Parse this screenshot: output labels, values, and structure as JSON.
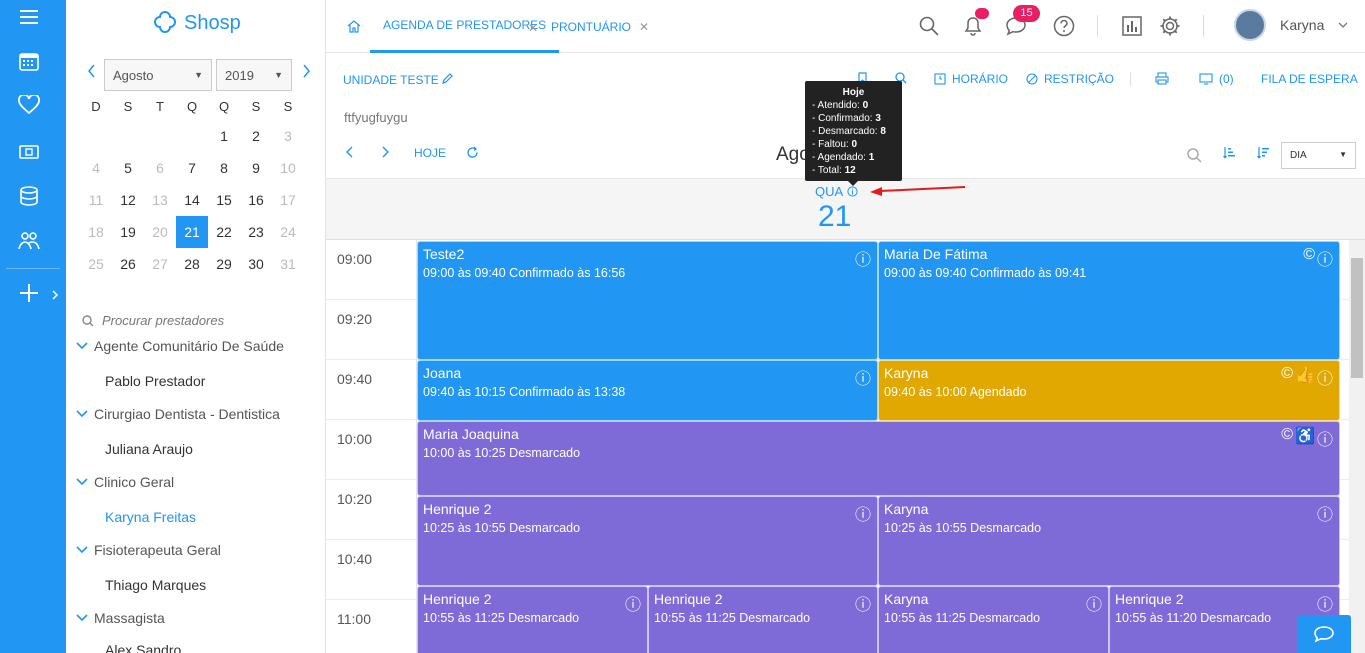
{
  "app": {
    "name": "Shosp"
  },
  "sidebar_rail": {
    "items": [
      "menu-icon",
      "calendar-icon",
      "heart-icon",
      "money-icon",
      "database-icon",
      "users-icon",
      "plus-icon"
    ]
  },
  "calendar": {
    "month": "Agosto",
    "year": "2019",
    "weekdays": [
      "D",
      "S",
      "T",
      "Q",
      "Q",
      "S",
      "S"
    ],
    "weeks": [
      [
        "",
        "",
        "",
        "",
        "1",
        "2",
        "3"
      ],
      [
        "4",
        "5",
        "6",
        "7",
        "8",
        "9",
        "10"
      ],
      [
        "11",
        "12",
        "13",
        "14",
        "15",
        "16",
        "17"
      ],
      [
        "18",
        "19",
        "20",
        "21",
        "22",
        "23",
        "24"
      ],
      [
        "25",
        "26",
        "27",
        "28",
        "29",
        "30",
        "31"
      ]
    ],
    "today": "21"
  },
  "provider_search": {
    "placeholder": "Procurar prestadores"
  },
  "groups": [
    {
      "name": "Agente Comunitário De Saúde",
      "providers": [
        "Pablo Prestador"
      ]
    },
    {
      "name": "Cirurgiao Dentista - Dentistica",
      "providers": [
        "Juliana Araujo"
      ]
    },
    {
      "name": "Clinico Geral",
      "providers": [
        "Karyna Freitas"
      ]
    },
    {
      "name": "Fisioterapeuta Geral",
      "providers": [
        "Thiago Marques"
      ]
    },
    {
      "name": "Massagista",
      "providers": [
        "Alex Sandro"
      ]
    }
  ],
  "tabs": [
    {
      "label": "AGENDA DE PRESTADORES"
    },
    {
      "label": "PRONTUÁRIO"
    }
  ],
  "header": {
    "messages_count": "15",
    "user_name": "Karyna"
  },
  "toolbar": {
    "unit": "UNIDADE TESTE",
    "horario": "HORÁRIO",
    "restricao": "RESTRIÇÃO",
    "waitlist_count": "(0)",
    "fila": "FILA DE ESPERA",
    "note": "ftfyugfuygu",
    "hoje": "HOJE",
    "title": "Agosto 2019",
    "view": "DIA"
  },
  "day": {
    "name": "QUA",
    "number": "21"
  },
  "tooltip": {
    "title": "Hoje",
    "rows": [
      {
        "label": "- Atendido: ",
        "value": "0"
      },
      {
        "label": "- Confirmado: ",
        "value": "3"
      },
      {
        "label": "- Desmarcado: ",
        "value": "8"
      },
      {
        "label": "- Faltou: ",
        "value": "0"
      },
      {
        "label": "- Agendado: ",
        "value": "1"
      },
      {
        "label": "- Total: ",
        "value": "12"
      }
    ]
  },
  "times": [
    "09:00",
    "09:20",
    "09:40",
    "10:00",
    "10:20",
    "10:40",
    "11:00"
  ],
  "events": [
    {
      "name": "Teste2",
      "detail": "09:00 às 09:40 Confirmado às 16:56",
      "status": "confirmado"
    },
    {
      "name": "Maria De Fátima",
      "detail": "09:00 às 09:40 Confirmado às 09:41",
      "status": "confirmado"
    },
    {
      "name": "Joana",
      "detail": "09:40 às 10:15 Confirmado às 13:38",
      "status": "confirmado"
    },
    {
      "name": "Karyna",
      "detail": "09:40 às 10:00 Agendado",
      "status": "agendado"
    },
    {
      "name": "Maria Joaquina",
      "detail": "10:00 às 10:25 Desmarcado",
      "status": "desmarcado"
    },
    {
      "name": "Henrique 2",
      "detail": "10:25 às 10:55 Desmarcado",
      "status": "desmarcado"
    },
    {
      "name": "Karyna",
      "detail": "10:25 às 10:55 Desmarcado",
      "status": "desmarcado"
    },
    {
      "name": "Henrique 2",
      "detail": "10:55 às 11:25 Desmarcado",
      "status": "desmarcado"
    },
    {
      "name": "Henrique 2",
      "detail": "10:55 às 11:25 Desmarcado",
      "status": "desmarcado"
    },
    {
      "name": "Karyna",
      "detail": "10:55 às 11:25 Desmarcado",
      "status": "desmarcado"
    },
    {
      "name": "Henrique 2",
      "detail": "10:55 às 11:20 Desmarcado",
      "status": "desmarcado"
    }
  ],
  "colors": {
    "accent": "#2196f3",
    "confirmado": "#2196f3",
    "agendado": "#e0a800",
    "desmarcado": "#7e6bd8",
    "badge": "#e91e63"
  }
}
